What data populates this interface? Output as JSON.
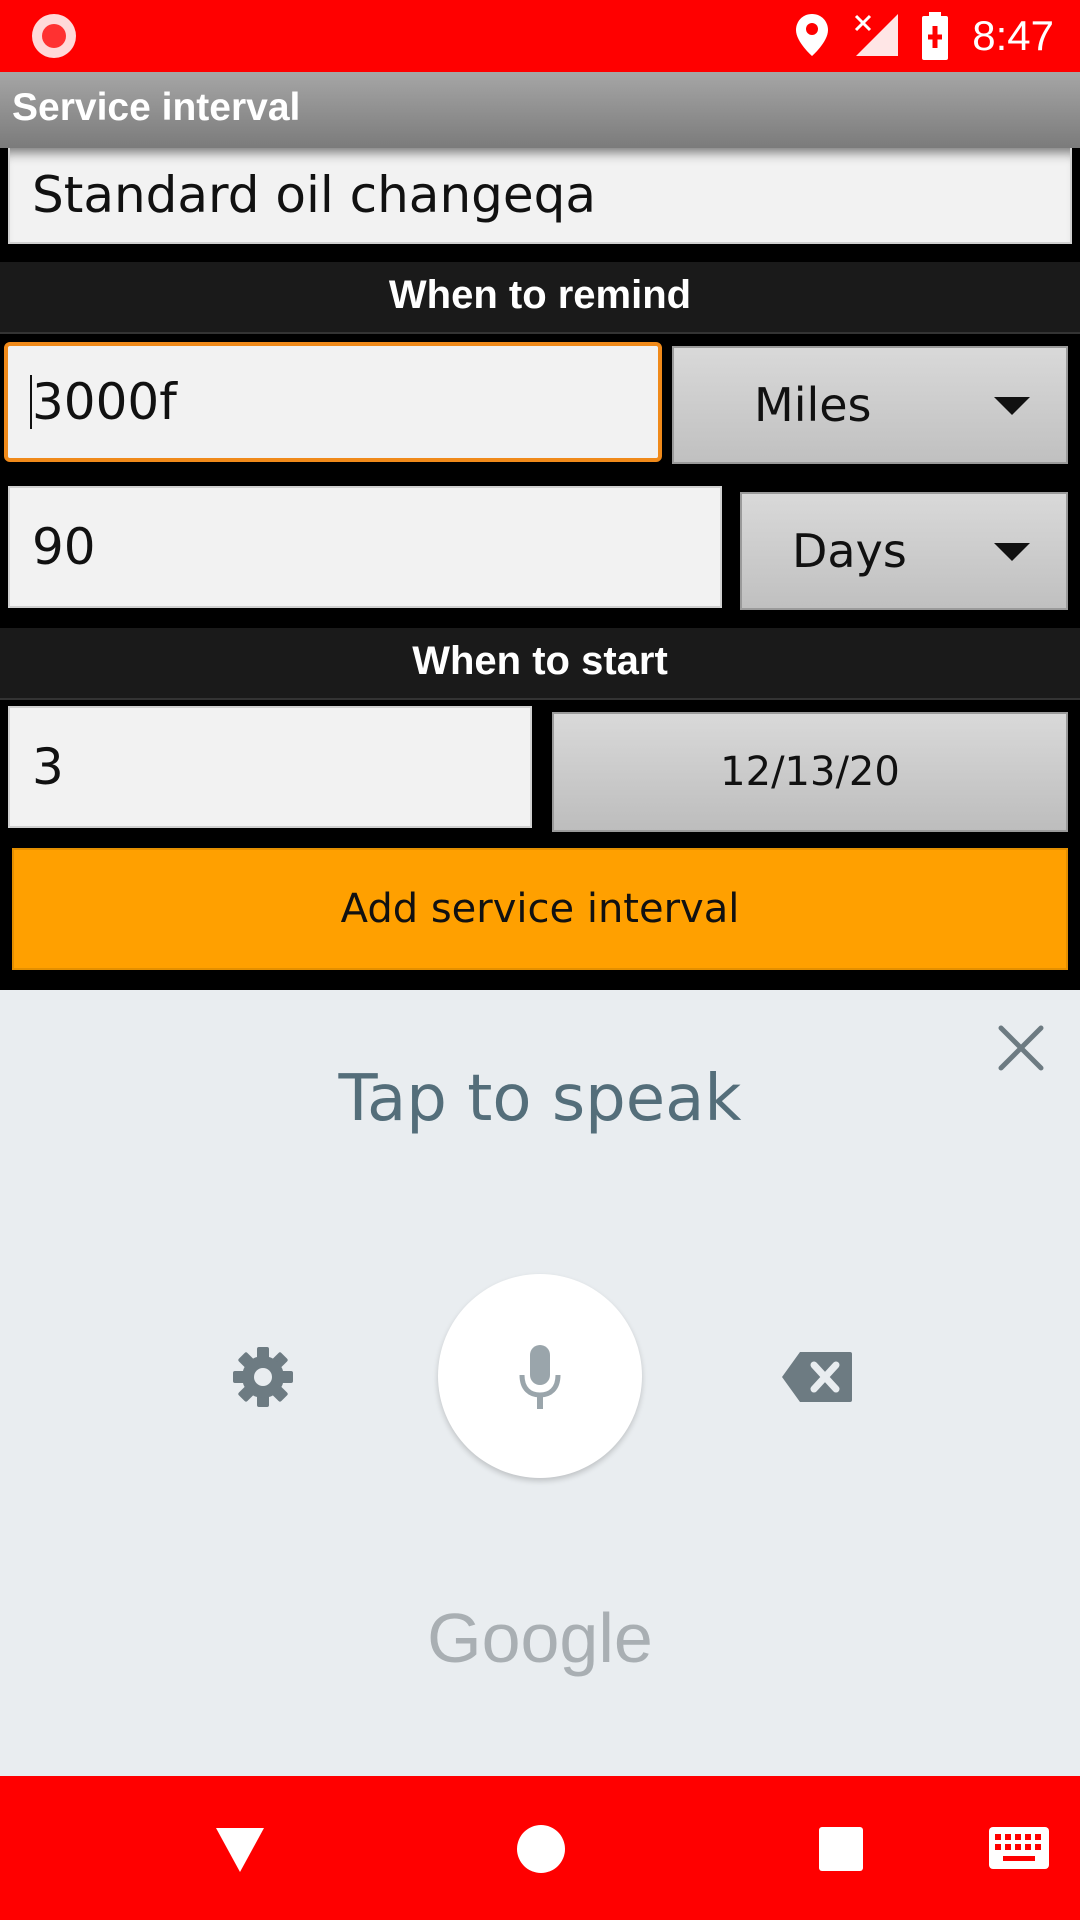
{
  "status_bar": {
    "time": "8:47"
  },
  "app_bar": {
    "title": "Service interval"
  },
  "form": {
    "name_value": "Standard oil changeqa",
    "section_remind": "When to remind",
    "distance_value": "3000f",
    "distance_unit": "Miles",
    "time_value": "90",
    "time_unit": "Days",
    "section_start": "When to start",
    "start_value": "3",
    "start_date": "12/13/20",
    "add_button": "Add service interval"
  },
  "voice_input": {
    "prompt": "Tap to speak",
    "brand": "Google"
  },
  "colors": {
    "status_bar": "#ff0000",
    "accent_button": "#ffa000",
    "focus_border": "#f08a1a",
    "voice_bg": "#e9edf0"
  },
  "icons": [
    "record-icon",
    "location-icon",
    "no-signal-icon",
    "battery-charging-icon",
    "close-icon",
    "gear-icon",
    "microphone-icon",
    "backspace-icon",
    "back-icon",
    "home-icon",
    "recents-icon",
    "keyboard-icon"
  ]
}
